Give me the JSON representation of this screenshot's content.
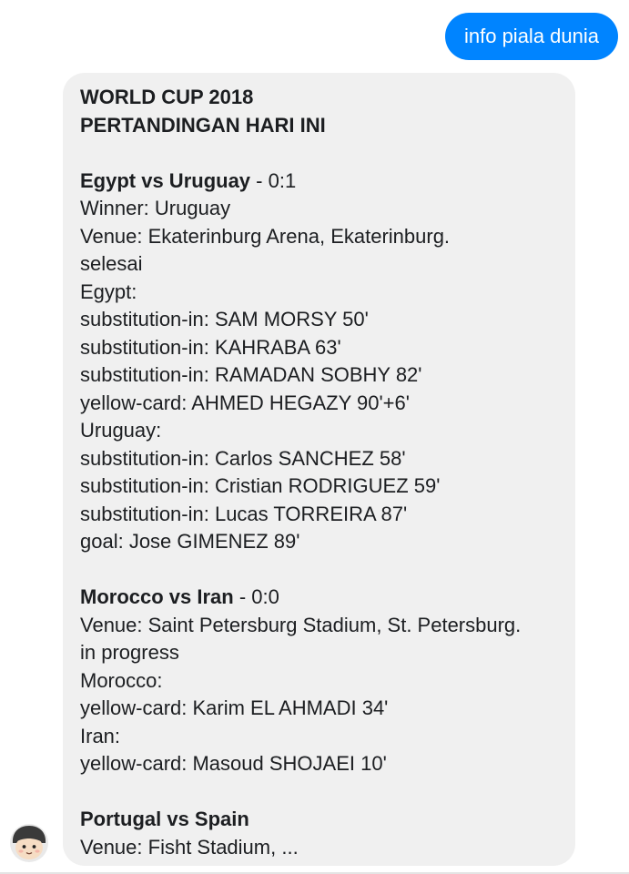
{
  "sent_message": {
    "text": "info piala dunia"
  },
  "reply": {
    "header_line1": "WORLD CUP 2018",
    "header_line2": "PERTANDINGAN HARI INI",
    "match1": {
      "teams": "Egypt vs Uruguay",
      "score": " - 0:1",
      "winner": "Winner: Uruguay",
      "venue": "Venue: Ekaterinburg Arena, Ekaterinburg.",
      "status": "selesai",
      "team_a": "Egypt:",
      "events_a": [
        "substitution-in: SAM MORSY 50'",
        "substitution-in: KAHRABA 63'",
        "substitution-in: RAMADAN SOBHY 82'",
        "yellow-card: AHMED HEGAZY 90'+6'"
      ],
      "team_b": "Uruguay:",
      "events_b": [
        "substitution-in: Carlos SANCHEZ 58'",
        "substitution-in: Cristian RODRIGUEZ 59'",
        "substitution-in: Lucas TORREIRA 87'",
        "goal: Jose GIMENEZ 89'"
      ]
    },
    "match2": {
      "teams": "Morocco vs Iran",
      "score": " - 0:0",
      "venue": "Venue: Saint Petersburg Stadium, St. Petersburg.",
      "status": "in progress",
      "team_a": "Morocco:",
      "events_a": [
        "yellow-card: Karim EL AHMADI 34'"
      ],
      "team_b": "Iran:",
      "events_b": [
        "yellow-card: Masoud SHOJAEI 10'"
      ]
    },
    "match3": {
      "teams": "Portugal vs Spain",
      "venue": "Venue: Fisht Stadium, ..."
    }
  },
  "avatar": {
    "icon": "cartoon-face-avatar-icon"
  },
  "colors": {
    "sent_bubble": "#0084ff",
    "received_bubble": "#f0f0f0",
    "text": "#1c1e21"
  }
}
